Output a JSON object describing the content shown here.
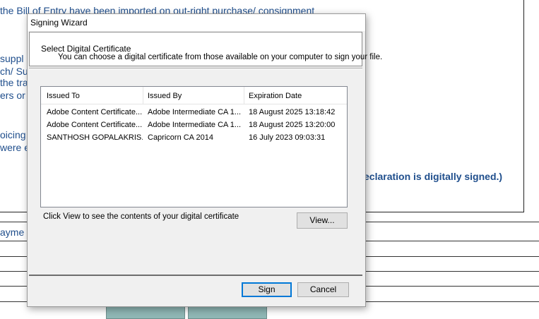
{
  "background_page": {
    "line1": "the Bill of Entry have been imported on out-right purchase/ consignment",
    "frag_suppl": "suppl",
    "frag_sub": "ch/ Sub",
    "frag_tra": "the tra",
    "frag_ers": "ers or",
    "frag_oicing": "oicing l",
    "frag_were": "were e",
    "declaration": "eclaration is digitally signed.)",
    "frag_payme": "ayme"
  },
  "dialog": {
    "title": "Signing Wizard",
    "header_title": "Select Digital Certificate",
    "header_desc": "You can choose a digital certificate from those available on your computer to sign your file.",
    "columns": [
      "Issued To",
      "Issued By",
      "Expiration Date"
    ],
    "rows": [
      {
        "issued_to": "Adobe Content Certificate...",
        "issued_by": "Adobe Intermediate CA 1...",
        "expiration": "18 August 2025 13:18:42"
      },
      {
        "issued_to": "Adobe Content Certificate...",
        "issued_by": "Adobe Intermediate CA 1...",
        "expiration": "18 August 2025 13:20:00"
      },
      {
        "issued_to": "SANTHOSH GOPALAKRIS...",
        "issued_by": "Capricorn CA 2014",
        "expiration": "16 July 2023 09:03:31"
      }
    ],
    "hint": "Click View to see the contents of your digital certificate",
    "view_label": "View...",
    "sign_label": "Sign",
    "cancel_label": "Cancel"
  },
  "colors": {
    "page_text": "#1f4e8c",
    "dialog_bg": "#f0f0f0",
    "default_button_border": "#0078d7"
  }
}
